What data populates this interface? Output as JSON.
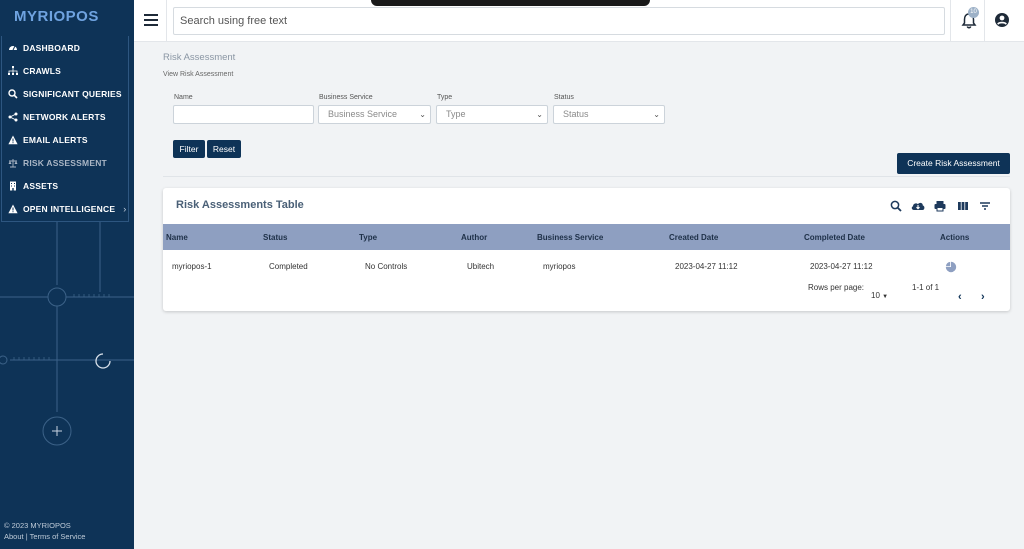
{
  "app": {
    "logo": "MYRIOPOS"
  },
  "sidebar": {
    "items": [
      {
        "label": "DASHBOARD",
        "icon": "gauge-icon"
      },
      {
        "label": "CRAWLS",
        "icon": "sitemap-icon"
      },
      {
        "label": "SIGNIFICANT QUERIES",
        "icon": "search-icon"
      },
      {
        "label": "NETWORK ALERTS",
        "icon": "share-icon"
      },
      {
        "label": "EMAIL ALERTS",
        "icon": "warning-icon"
      },
      {
        "label": "RISK ASSESSMENT",
        "icon": "scale-icon"
      },
      {
        "label": "ASSETS",
        "icon": "building-icon"
      },
      {
        "label": "OPEN INTELLIGENCE",
        "icon": "warning-icon"
      }
    ],
    "footer": {
      "copyright": "© 2023 MYRIOPOS",
      "about": "About",
      "sep": " | ",
      "terms": "Terms of Service"
    }
  },
  "topbar": {
    "search_placeholder": "Search using free text",
    "notifications": "10"
  },
  "page": {
    "title": "Risk Assessment",
    "breadcrumb": "View Risk Assessment",
    "filters": {
      "name_label": "Name",
      "name_value": "",
      "business_service_label": "Business Service",
      "business_service_value": "Business Service",
      "type_label": "Type",
      "type_value": "Type",
      "status_label": "Status",
      "status_value": "Status",
      "filter_button": "Filter",
      "reset_button": "Reset"
    },
    "create_button": "Create Risk Assessment"
  },
  "table": {
    "title": "Risk Assessments Table",
    "columns": [
      "Name",
      "Status",
      "Type",
      "Author",
      "Business Service",
      "Created Date",
      "Completed Date",
      "Actions"
    ],
    "rows": [
      [
        "myriopos-1",
        "Completed",
        "No Controls",
        "Ubitech",
        "myriopos",
        "2023-04-27 11:12",
        "2023-04-27 11:12"
      ]
    ],
    "rows_per_page_label": "Rows per page:",
    "rows_per_page": "10",
    "range": "1-1 of 1"
  }
}
